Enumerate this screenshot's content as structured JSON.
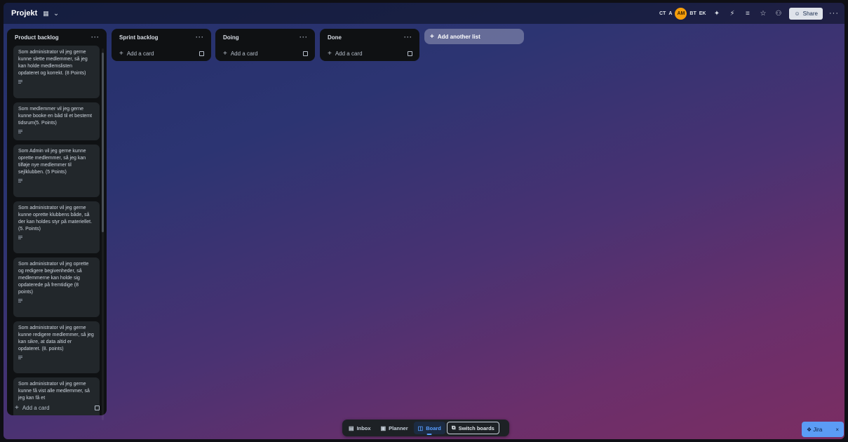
{
  "board": {
    "title": "Projekt",
    "icon": "board-view-icon",
    "members": [
      "CT",
      "A",
      "AM",
      "BT",
      "EK"
    ],
    "share_label": "Share",
    "add_list_label": "Add another list"
  },
  "lists": [
    {
      "title": "Product backlog",
      "add_label": "Add a card",
      "cards": [
        "Som administrator vil jeg gerne kunne slette medlemmer, så jeg kan holde medlemslisten opdateret og korrekt. (8 Points)",
        "Som medlemmer vil jeg gerne kunne booke en båd til et bestemt tidsrum(5. Points)",
        "Som Admin vil jeg gerne kunne oprette medlemmer, så jeg kan tilføje nye medlemmer til sejlklubben. (5 Points)",
        "Som administrator vil jeg gerne kunne oprette klubbens både, så der kan holdes styr på materiellet. (5. Points)",
        "Som administrator vil jeg oprette og redigere begivenheder, så medlemmerne kan holde sig opdaterede på fremtidige (8 points)",
        "Som administrator vil jeg gerne kunne redigere medlemmer, så jeg kan sikre, at data altid er opdateret. (8. points)",
        "Som administrator vil jeg gerne kunne få vist alle medlemmer, så jeg kan få et"
      ]
    },
    {
      "title": "Sprint backlog",
      "add_label": "Add a card"
    },
    {
      "title": "Doing",
      "add_label": "Add a card"
    },
    {
      "title": "Done",
      "add_label": "Add a card"
    }
  ],
  "bottom_nav": {
    "inbox": "Inbox",
    "planner": "Planner",
    "board": "Board",
    "switch": "Switch boards"
  },
  "jira": {
    "label": "Jira"
  }
}
